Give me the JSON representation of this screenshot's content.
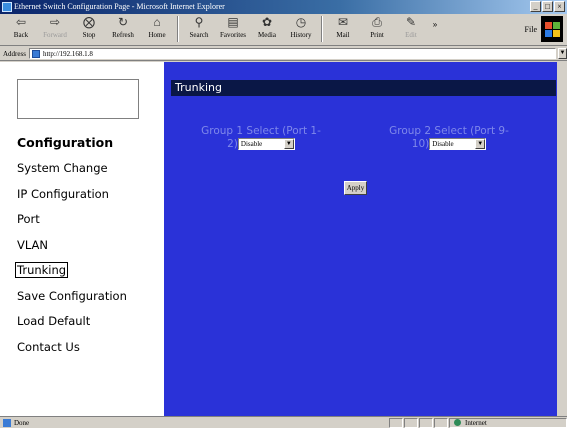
{
  "window": {
    "title": "Ethernet Switch Configuration Page - Microsoft Internet Explorer",
    "buttons": [
      "_",
      "□",
      "×"
    ]
  },
  "toolbar": {
    "back": "Back",
    "forward": "Forward",
    "stop": "Stop",
    "refresh": "Refresh",
    "home": "Home",
    "search": "Search",
    "favorites": "Favorites",
    "media": "Media",
    "history": "History",
    "mail": "Mail",
    "print": "Print",
    "edit": "Edit",
    "more": "»",
    "file": "File"
  },
  "address": {
    "label": "Address",
    "url": "http://192.168.1.8"
  },
  "sidebar": {
    "heading": "Configuration",
    "items": [
      {
        "label": "System Change"
      },
      {
        "label": "IP Configuration"
      },
      {
        "label": "Port"
      },
      {
        "label": "VLAN"
      },
      {
        "label": "Trunking",
        "active": true
      },
      {
        "label": "Save Configuration"
      },
      {
        "label": "Load Default"
      },
      {
        "label": "Contact Us"
      }
    ]
  },
  "main": {
    "header": "Trunking",
    "groups": [
      {
        "label_line1": "Group 1 Select (Port 1-",
        "label_line2": "2)",
        "selected": "Disable"
      },
      {
        "label_line1": "Group 2 Select (Port 9-",
        "label_line2": "10)",
        "selected": "Disable"
      }
    ],
    "apply_label": "Apply"
  },
  "status": {
    "text": "Done",
    "zone": "Internet"
  },
  "colors": {
    "main_background": "#2a32d8",
    "header_bar": "#0a1746",
    "group_label": "#7f88ea"
  }
}
